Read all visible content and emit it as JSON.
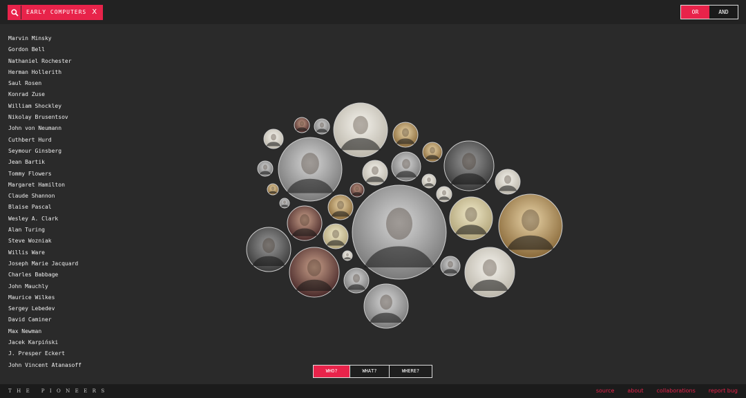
{
  "search": {
    "tag_label": "EARLY COMPUTERS",
    "close_label": "X",
    "icon": "search-icon"
  },
  "logic_toggle": {
    "options": [
      "OR",
      "AND"
    ],
    "selected": "OR"
  },
  "pioneers": [
    "Marvin Minsky",
    "Gordon Bell",
    "Nathaniel Rochester",
    "Herman Hollerith",
    "Saul Rosen",
    "Konrad Zuse",
    "William Shockley",
    "Nikolay Brusentsov",
    "John von Neumann",
    "Cuthbert Hurd",
    "Seymour Ginsberg",
    "Jean Bartik",
    "Tommy Flowers",
    "Margaret Hamilton",
    "Claude Shannon",
    "Blaise Pascal",
    "Wesley A. Clark",
    "Alan Turing",
    "Steve Wozniak",
    "Willis Ware",
    "Joseph Marie Jacquard",
    "Charles Babbage",
    "John Mauchly",
    "Maurice Wilkes",
    "Sergey Lebedev",
    "David Caminer",
    "Max Newman",
    "Jacek Karpiński",
    "J. Presper Eckert",
    "John Vincent Atanasoff"
  ],
  "view_tabs": [
    {
      "label": "WHO?",
      "active": true
    },
    {
      "label": "WHAT?",
      "active": false
    },
    {
      "label": "WHERE?",
      "active": false
    }
  ],
  "footer": {
    "brand": "THE PIONEERS",
    "links": [
      "source",
      "about",
      "collaborations",
      "report bug"
    ]
  },
  "colors": {
    "accent": "#e8234a",
    "background": "#2a2a2a",
    "bar": "#222222"
  }
}
